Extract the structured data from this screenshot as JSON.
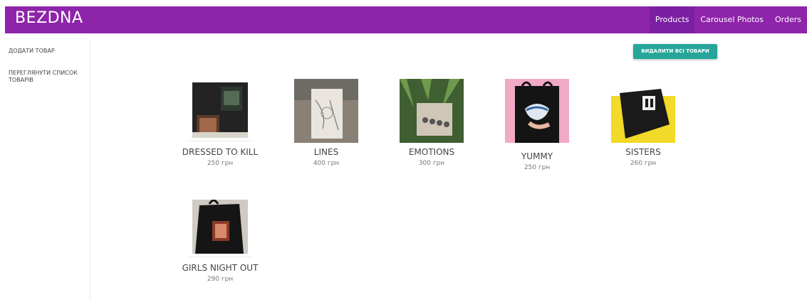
{
  "navbar": {
    "brand": "BEZDNA",
    "links": [
      {
        "label": "Products",
        "active": true
      },
      {
        "label": "Carousel Photos",
        "active": false
      },
      {
        "label": "Orders",
        "active": false
      }
    ],
    "color": "#8e24aa"
  },
  "sidebar": {
    "items": [
      {
        "label": "ДОДАТИ ТОВАР"
      },
      {
        "label": "ПЕРЕГЛЯНУТИ СПИСОК ТОВАРІВ"
      }
    ]
  },
  "actions": {
    "delete_all_label": "ВИДАЛИТИ ВСІ ТОВАРИ",
    "button_color": "#26a69a"
  },
  "products": [
    {
      "name": "DRESSED TO KILL",
      "price": "250 грн"
    },
    {
      "name": "LINES",
      "price": "400 грн"
    },
    {
      "name": "EMOTIONS",
      "price": "300 грн"
    },
    {
      "name": "YUMMY",
      "price": "250 грн"
    },
    {
      "name": "SISTERS",
      "price": "260 грн"
    },
    {
      "name": "GIRLS NIGHT OUT",
      "price": "290 грн"
    }
  ]
}
